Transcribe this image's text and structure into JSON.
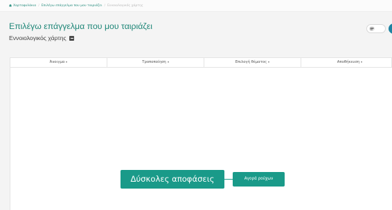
{
  "breadcrumb": {
    "home_icon": "home-icon",
    "items": [
      "Χαρτοφυλάκιο",
      "Επιλέγω επάγγελμα που μου ταιριάζει",
      "Εννοιολογικός χάρτης"
    ],
    "separator": "/"
  },
  "page": {
    "title": "Επιλέγω επάγγελμα που μου ταιριάζει",
    "subtitle": "Εννοιολογικός χάρτης",
    "subtitle_icon": "collapse-icon"
  },
  "toolbar": {
    "menus": [
      {
        "label": "Άνοιγμα"
      },
      {
        "label": "Τροποποίηση"
      },
      {
        "label": "Επιλογή θέματος"
      },
      {
        "label": "Αποθήκευση"
      }
    ],
    "caret_icon": "caret-down-icon"
  },
  "mindmap": {
    "central_node": "Δύσκολες αποφάσεις",
    "child_nodes": [
      "Αγορά ρούχων"
    ],
    "node_color": "#1a9a89"
  },
  "colors": {
    "accent": "#1e8677",
    "node": "#1a9a89",
    "fab": "#1f83a2"
  }
}
